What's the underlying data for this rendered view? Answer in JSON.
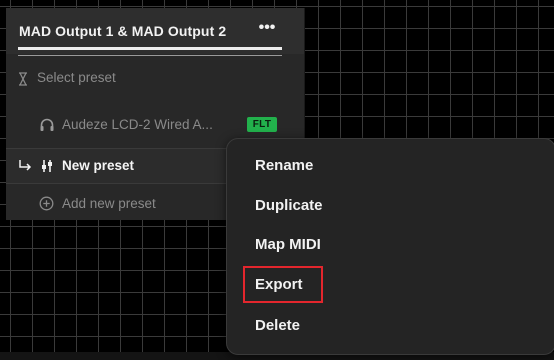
{
  "panel": {
    "title": "MAD Output 1 & MAD Output 2",
    "more_icon": "ellipsis-icon",
    "more_label": "•••"
  },
  "presets": {
    "select_label": "Select preset",
    "select_icon": "hourglass-icon",
    "items": [
      {
        "label": "Audeze LCD-2 Wired A...",
        "icon": "headphones-icon",
        "badge": "FLT",
        "badge_color": "#22b14c"
      },
      {
        "label": "New preset",
        "icon": "sliders-icon",
        "branch_icon": "return-arrow-icon",
        "active": true
      }
    ],
    "add_label": "Add new preset",
    "add_icon": "plus-circle-icon"
  },
  "context_menu": {
    "items": [
      "Rename",
      "Duplicate",
      "Map MIDI",
      "Export",
      "Delete"
    ],
    "highlighted": "Export",
    "highlight_color": "#e3262d"
  }
}
